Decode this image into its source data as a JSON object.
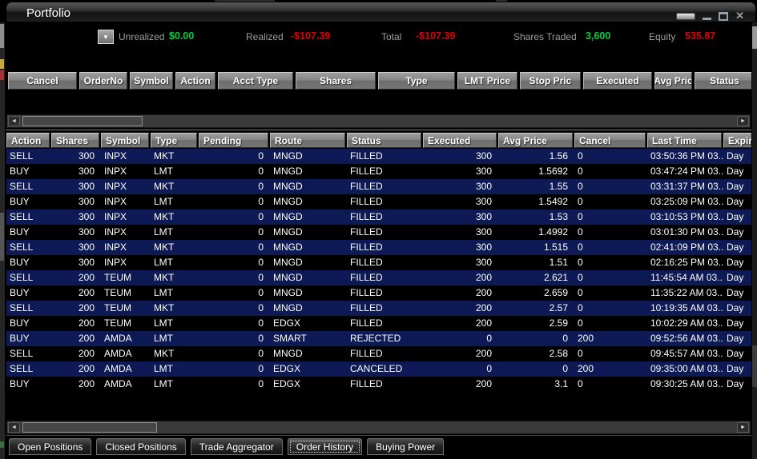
{
  "window": {
    "title": "Portfolio"
  },
  "icons": {
    "dropdown": "▼",
    "scroll_left": "◄",
    "scroll_right": "►",
    "close": "✕"
  },
  "colors": {
    "positive": "#00d23c",
    "negative": "#e00000",
    "row_alt": "#0d1a55"
  },
  "stats": {
    "items": [
      {
        "label": "Unrealized",
        "value": "$0.00",
        "tone": "positive"
      },
      {
        "label": "Realized",
        "value": "-$107.39",
        "tone": "negative"
      },
      {
        "label": "Total",
        "value": "-$107.39",
        "tone": "negative"
      },
      {
        "label": "Shares Traded",
        "value": "3,600",
        "tone": "positive"
      },
      {
        "label": "Equity",
        "value": "535.87",
        "tone": "negative"
      }
    ]
  },
  "order_entry_header": {
    "columns": [
      "Cancel",
      "OrderNo",
      "Symbol",
      "Action",
      "Acct Type",
      "Shares",
      "Type",
      "LMT Price",
      "Stop Pric",
      "Executed",
      "Avg Pric",
      "Status"
    ]
  },
  "order_table": {
    "columns": [
      "Action",
      "Shares",
      "Symbol",
      "Type",
      "Pending",
      "Route",
      "Status",
      "Executed",
      "Avg Price",
      "Cancel",
      "Last Time",
      "Expir"
    ],
    "rows": [
      [
        "SELL",
        "300",
        "INPX",
        "MKT",
        "0",
        "MNGD",
        "FILLED",
        "300",
        "1.56",
        "0",
        "03:50:36 PM 03...",
        "Day"
      ],
      [
        "BUY",
        "300",
        "INPX",
        "LMT",
        "0",
        "MNGD",
        "FILLED",
        "300",
        "1.5692",
        "0",
        "03:47:24 PM 03...",
        "Day"
      ],
      [
        "SELL",
        "300",
        "INPX",
        "MKT",
        "0",
        "MNGD",
        "FILLED",
        "300",
        "1.55",
        "0",
        "03:31:37 PM 03...",
        "Day"
      ],
      [
        "BUY",
        "300",
        "INPX",
        "LMT",
        "0",
        "MNGD",
        "FILLED",
        "300",
        "1.5492",
        "0",
        "03:25:09 PM 03...",
        "Day"
      ],
      [
        "SELL",
        "300",
        "INPX",
        "MKT",
        "0",
        "MNGD",
        "FILLED",
        "300",
        "1.53",
        "0",
        "03:10:53 PM 03...",
        "Day"
      ],
      [
        "BUY",
        "300",
        "INPX",
        "LMT",
        "0",
        "MNGD",
        "FILLED",
        "300",
        "1.4992",
        "0",
        "03:01:30 PM 03...",
        "Day"
      ],
      [
        "SELL",
        "300",
        "INPX",
        "MKT",
        "0",
        "MNGD",
        "FILLED",
        "300",
        "1.515",
        "0",
        "02:41:09 PM 03...",
        "Day"
      ],
      [
        "BUY",
        "300",
        "INPX",
        "LMT",
        "0",
        "MNGD",
        "FILLED",
        "300",
        "1.51",
        "0",
        "02:16:25 PM 03...",
        "Day"
      ],
      [
        "SELL",
        "200",
        "TEUM",
        "MKT",
        "0",
        "MNGD",
        "FILLED",
        "200",
        "2.621",
        "0",
        "11:45:54 AM 03...",
        "Day"
      ],
      [
        "BUY",
        "200",
        "TEUM",
        "LMT",
        "0",
        "MNGD",
        "FILLED",
        "200",
        "2.659",
        "0",
        "11:35:22 AM 03...",
        "Day"
      ],
      [
        "SELL",
        "200",
        "TEUM",
        "MKT",
        "0",
        "MNGD",
        "FILLED",
        "200",
        "2.57",
        "0",
        "10:19:35 AM 03...",
        "Day"
      ],
      [
        "BUY",
        "200",
        "TEUM",
        "LMT",
        "0",
        "EDGX",
        "FILLED",
        "200",
        "2.59",
        "0",
        "10:02:29 AM 03...",
        "Day"
      ],
      [
        "BUY",
        "200",
        "AMDA",
        "LMT",
        "0",
        "SMART",
        "REJECTED",
        "0",
        "0",
        "200",
        "09:52:56 AM 03...",
        "Day"
      ],
      [
        "SELL",
        "200",
        "AMDA",
        "MKT",
        "0",
        "MNGD",
        "FILLED",
        "200",
        "2.58",
        "0",
        "09:45:57 AM 03...",
        "Day"
      ],
      [
        "SELL",
        "200",
        "AMDA",
        "LMT",
        "0",
        "EDGX",
        "CANCELED",
        "0",
        "0",
        "200",
        "09:35:00 AM 03...",
        "Day"
      ],
      [
        "BUY",
        "200",
        "AMDA",
        "LMT",
        "0",
        "EDGX",
        "FILLED",
        "200",
        "3.1",
        "0",
        "09:30:25 AM 03...",
        "Day"
      ]
    ]
  },
  "tabs": [
    {
      "label": "Open Positions",
      "selected": false
    },
    {
      "label": "Closed Positions",
      "selected": false
    },
    {
      "label": "Trade Aggregator",
      "selected": false
    },
    {
      "label": "Order History",
      "selected": true
    },
    {
      "label": "Buying Power",
      "selected": false
    }
  ]
}
